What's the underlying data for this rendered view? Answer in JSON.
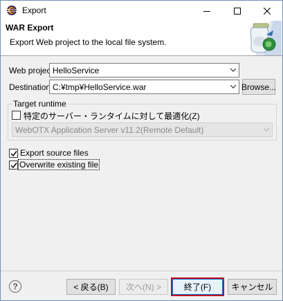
{
  "window": {
    "title": "Export",
    "minimize_icon": "minimize-icon",
    "maximize_icon": "maximize-icon",
    "close_icon": "close-icon"
  },
  "banner": {
    "title": "WAR Export",
    "description": "Export Web project to the local file system.",
    "image_icon": "war-export-wizard-icon"
  },
  "form": {
    "web_project_label": "Web project:",
    "web_project_value": "HelloService",
    "destination_label": "Destination:",
    "destination_value": "C:¥tmp¥HelloService.war",
    "browse_label": "Browse...",
    "target_runtime_label": "Target runtime",
    "optimize_label": "特定のサーバー・ランタイムに対して最適化(Z)",
    "optimize_checked": false,
    "runtime_value": "WebOTX Application Server v11.2(Remote Default)",
    "export_source_label": "Export source files",
    "export_source_checked": true,
    "overwrite_label": "Overwrite existing file",
    "overwrite_checked": true
  },
  "footer": {
    "help_label": "?",
    "back_label": "< 戻る(B)",
    "next_label": "次へ(N) >",
    "finish_label": "終了(F)",
    "cancel_label": "キャンセル"
  },
  "colors": {
    "highlight_border": "#c4001a",
    "window_bg": "#f0f0f0",
    "title_bg": "#ffffff"
  }
}
